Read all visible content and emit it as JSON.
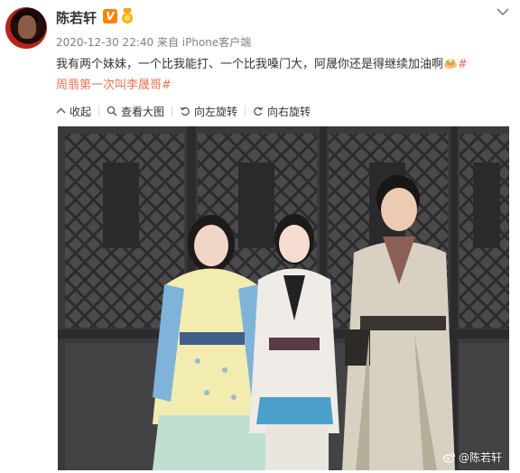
{
  "post": {
    "username": "陈若轩",
    "verified_badge": "V",
    "timestamp": "2020-12-30 22:40",
    "source": "来自 iPhone客户端",
    "text_main": "我有两个妹妹，一个比我能打、一个比我嗓门大，阿晟你还是得继续加油啊",
    "topic_part1": "#",
    "topic_part2": "周翡第一次叫李晟哥#"
  },
  "toolbar": {
    "collapse_label": "收起",
    "view_large_label": "查看大图",
    "rotate_left_label": "向左旋转",
    "rotate_right_label": "向右旋转"
  },
  "photo": {
    "watermark": "@陈若轩"
  },
  "colors": {
    "accent_orange": "#ff8200",
    "topic_link": "#eb7350",
    "meta_gray": "#808080",
    "avatar_red": "#c8261e"
  },
  "icons": {
    "more": "chevron-down-icon",
    "collapse": "collapse-up-icon",
    "view_large": "magnifier-icon",
    "rotate_left": "rotate-left-icon",
    "rotate_right": "rotate-right-icon"
  }
}
